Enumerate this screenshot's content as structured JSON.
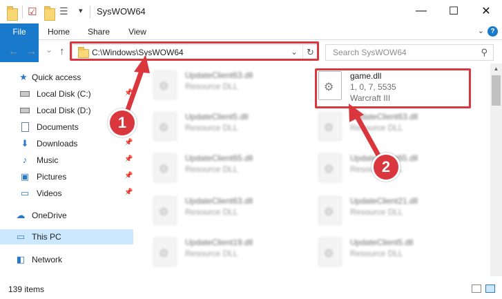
{
  "window": {
    "title": "SysWOW64",
    "minimize_glyph": "—",
    "maximize_glyph": "☐",
    "close_glyph": "✕"
  },
  "quick_access_toolbar": {
    "items": [
      "folder-icon",
      "properties-icon",
      "new-folder-icon",
      "view-icon"
    ],
    "dropdown_glyph": "▾"
  },
  "ribbon": {
    "tabs": [
      "File",
      "Home",
      "Share",
      "View"
    ],
    "file_tab_color": "#1979ca",
    "expand_glyph": "⌄",
    "help_glyph": "?"
  },
  "navigation": {
    "back_glyph": "←",
    "forward_glyph": "→",
    "recent_glyph": "⌄",
    "up_glyph": "↑",
    "address_path": "C:\\Windows\\SysWOW64",
    "address_dropdown_glyph": "⌄",
    "refresh_glyph": "↻",
    "search_placeholder": "Search SysWOW64",
    "search_glyph": "⚲"
  },
  "nav_pane": {
    "items": [
      {
        "label": "Quick access",
        "icon": "★",
        "pinned": false,
        "level": 0
      },
      {
        "label": "Local Disk (C:)",
        "icon": "drive",
        "pinned": true,
        "level": 1
      },
      {
        "label": "Local Disk (D:)",
        "icon": "drive",
        "pinned": false,
        "level": 1
      },
      {
        "label": "Documents",
        "icon": "doc",
        "pinned": true,
        "level": 1
      },
      {
        "label": "Downloads",
        "icon": "⬇",
        "pinned": true,
        "level": 1
      },
      {
        "label": "Music",
        "icon": "♪",
        "pinned": true,
        "level": 1
      },
      {
        "label": "Pictures",
        "icon": "▣",
        "pinned": true,
        "level": 1
      },
      {
        "label": "Videos",
        "icon": "▭",
        "pinned": true,
        "level": 1
      },
      {
        "label": "OneDrive",
        "icon": "☁",
        "pinned": false,
        "level": 0
      },
      {
        "label": "This PC",
        "icon": "▭",
        "pinned": false,
        "level": 0,
        "selected": true
      },
      {
        "label": "Network",
        "icon": "◧",
        "pinned": false,
        "level": 0
      }
    ],
    "pin_glyph": "📌"
  },
  "files": {
    "left_column": [
      {
        "name": "UpdateClient63.dll",
        "desc": "Resource DLL"
      },
      {
        "name": "UpdateClient5.dll",
        "desc": "Resource DLL"
      },
      {
        "name": "UpdateClient65.dll",
        "desc": "Resource DLL"
      },
      {
        "name": "UpdateClient63.dll",
        "desc": "Resource DLL"
      },
      {
        "name": "UpdateClient19.dll",
        "desc": "Resource DLL"
      }
    ],
    "highlighted": {
      "name": "game.dll",
      "version": "1, 0, 7, 5535",
      "product": "Warcraft III"
    },
    "right_column": [
      {
        "name": "UpdateClient63.dll",
        "desc": "Resource DLL"
      },
      {
        "name": "UpdateClient65.dll",
        "desc": "Resource DLL"
      },
      {
        "name": "UpdateClient21.dll",
        "desc": "Resource DLL"
      },
      {
        "name": "UpdateClient5.dll",
        "desc": "Resource DLL"
      }
    ]
  },
  "annotations": {
    "step1": "1",
    "step2": "2",
    "color": "#d9363e"
  },
  "status_bar": {
    "item_count": "139 items"
  }
}
